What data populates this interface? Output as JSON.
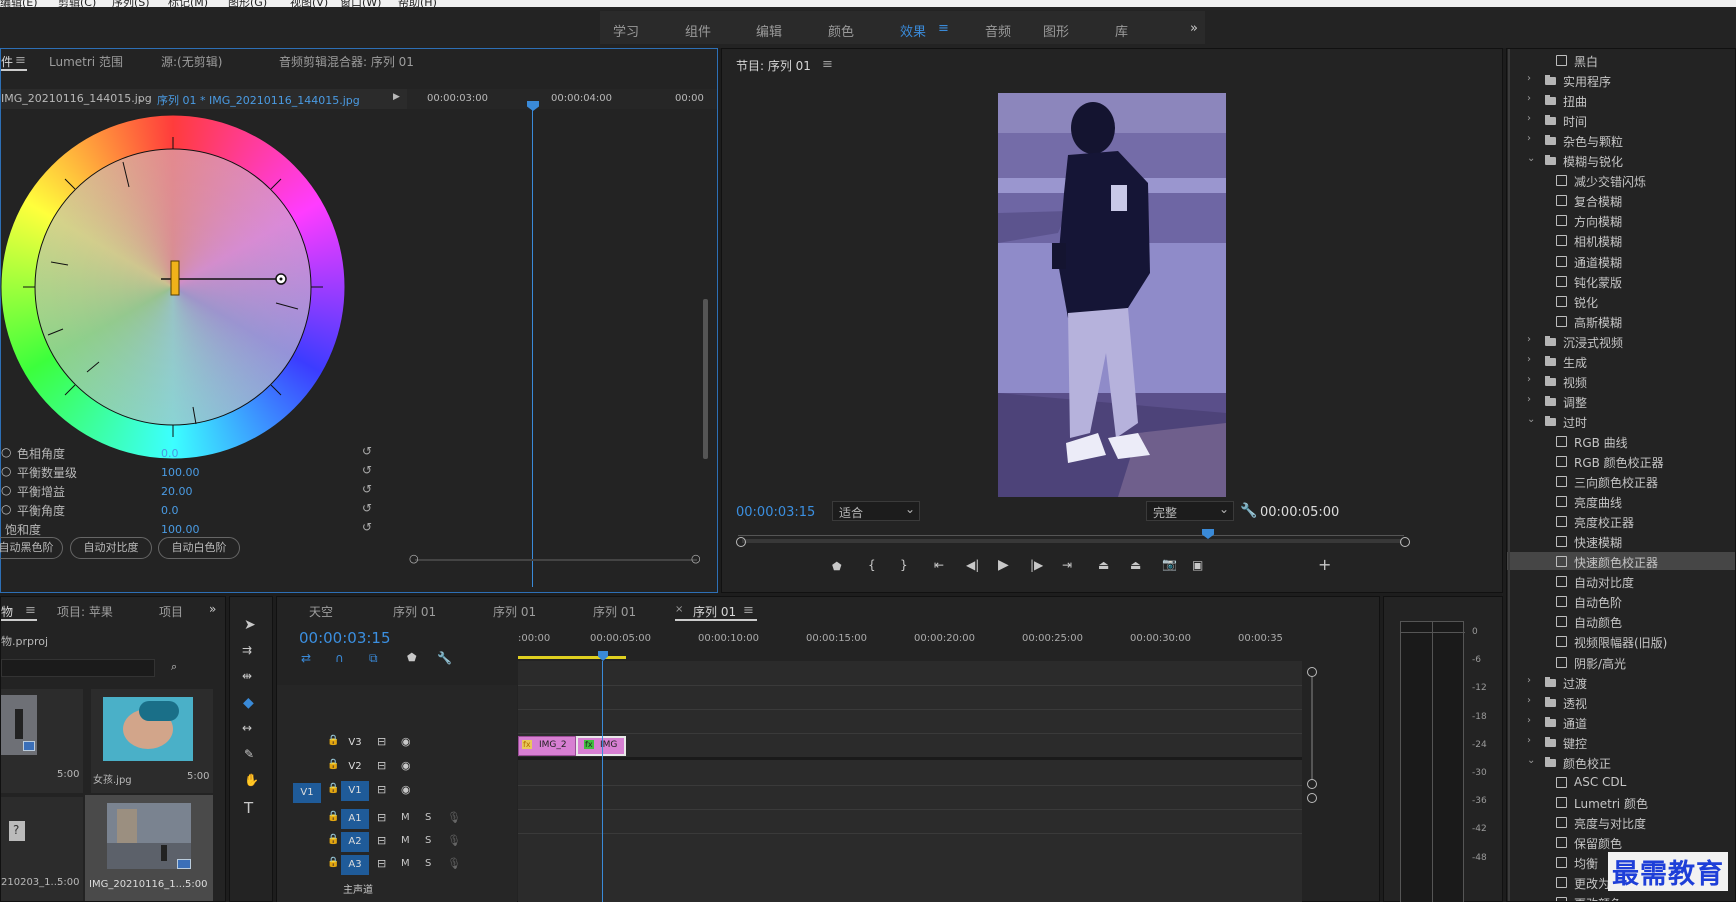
{
  "menubar": {
    "items": [
      "编辑(E)",
      "剪辑(C)",
      "序列(S)",
      "标记(M)",
      "图形(G)",
      "视图(V)",
      "窗口(W)",
      "帮助(H)"
    ]
  },
  "workspace": {
    "tabs": [
      "学习",
      "组件",
      "编辑",
      "颜色",
      "效果",
      "音频",
      "图形",
      "库"
    ],
    "active": "效果",
    "more": "»"
  },
  "source_panel": {
    "tabs": [
      "件",
      "Lumetri 范围",
      "源:(无剪辑)",
      "音频剪辑混合器: 序列 01"
    ],
    "clip_left": "IMG_20210116_144015.jpg",
    "clip_right": "序列 01 * IMG_20210116_144015.jpg",
    "timecodes": [
      "00:00:03:00",
      "00:00:04:00",
      "00:00"
    ],
    "params": [
      {
        "label": "色相角度",
        "value": "0.0"
      },
      {
        "label": "平衡数量级",
        "value": "100.00"
      },
      {
        "label": "平衡增益",
        "value": "20.00"
      },
      {
        "label": "平衡角度",
        "value": "0.0"
      },
      {
        "label": "饱和度",
        "value": "100.00"
      }
    ],
    "buttons": [
      "自动黑色阶",
      "自动对比度",
      "自动白色阶"
    ]
  },
  "program_panel": {
    "title": "节目: 序列 01",
    "current_time": "00:00:03:15",
    "fit": "适合",
    "quality": "完整",
    "duration": "00:00:05:00"
  },
  "effects_panel": {
    "items": [
      {
        "label": "黑白",
        "level": 2,
        "kind": "fx"
      },
      {
        "label": "实用程序",
        "level": 1,
        "kind": "folder"
      },
      {
        "label": "扭曲",
        "level": 1,
        "kind": "folder"
      },
      {
        "label": "时间",
        "level": 1,
        "kind": "folder"
      },
      {
        "label": "杂色与颗粒",
        "level": 1,
        "kind": "folder"
      },
      {
        "label": "模糊与锐化",
        "level": 1,
        "kind": "folder-open"
      },
      {
        "label": "减少交错闪烁",
        "level": 2,
        "kind": "fx"
      },
      {
        "label": "复合模糊",
        "level": 2,
        "kind": "fx"
      },
      {
        "label": "方向模糊",
        "level": 2,
        "kind": "fx"
      },
      {
        "label": "相机模糊",
        "level": 2,
        "kind": "fx"
      },
      {
        "label": "通道模糊",
        "level": 2,
        "kind": "fx"
      },
      {
        "label": "钝化蒙版",
        "level": 2,
        "kind": "fx"
      },
      {
        "label": "锐化",
        "level": 2,
        "kind": "fx"
      },
      {
        "label": "高斯模糊",
        "level": 2,
        "kind": "fx"
      },
      {
        "label": "沉浸式视频",
        "level": 1,
        "kind": "folder"
      },
      {
        "label": "生成",
        "level": 1,
        "kind": "folder"
      },
      {
        "label": "视频",
        "level": 1,
        "kind": "folder"
      },
      {
        "label": "调整",
        "level": 1,
        "kind": "folder"
      },
      {
        "label": "过时",
        "level": 1,
        "kind": "folder-open"
      },
      {
        "label": "RGB 曲线",
        "level": 2,
        "kind": "fx"
      },
      {
        "label": "RGB 颜色校正器",
        "level": 2,
        "kind": "fx"
      },
      {
        "label": "三向颜色校正器",
        "level": 2,
        "kind": "fx"
      },
      {
        "label": "亮度曲线",
        "level": 2,
        "kind": "fx"
      },
      {
        "label": "亮度校正器",
        "level": 2,
        "kind": "fx"
      },
      {
        "label": "快速模糊",
        "level": 2,
        "kind": "fx"
      },
      {
        "label": "快速颜色校正器",
        "level": 2,
        "kind": "fx",
        "selected": true
      },
      {
        "label": "自动对比度",
        "level": 2,
        "kind": "fx"
      },
      {
        "label": "自动色阶",
        "level": 2,
        "kind": "fx"
      },
      {
        "label": "自动颜色",
        "level": 2,
        "kind": "fx"
      },
      {
        "label": "视频限幅器(旧版)",
        "level": 2,
        "kind": "fx"
      },
      {
        "label": "阴影/高光",
        "level": 2,
        "kind": "fx"
      },
      {
        "label": "过渡",
        "level": 1,
        "kind": "folder"
      },
      {
        "label": "透视",
        "level": 1,
        "kind": "folder"
      },
      {
        "label": "通道",
        "level": 1,
        "kind": "folder"
      },
      {
        "label": "键控",
        "level": 1,
        "kind": "folder"
      },
      {
        "label": "颜色校正",
        "level": 1,
        "kind": "folder-open"
      },
      {
        "label": "ASC CDL",
        "level": 2,
        "kind": "fx"
      },
      {
        "label": "Lumetri 颜色",
        "level": 2,
        "kind": "fx"
      },
      {
        "label": "亮度与对比度",
        "level": 2,
        "kind": "fx"
      },
      {
        "label": "保留颜色",
        "level": 2,
        "kind": "fx"
      },
      {
        "label": "均衡",
        "level": 2,
        "kind": "fx"
      },
      {
        "label": "更改为颜色",
        "level": 2,
        "kind": "fx"
      },
      {
        "label": "更改颜色",
        "level": 2,
        "kind": "fx"
      }
    ]
  },
  "project_panel": {
    "tabs": [
      "物",
      "项目: 苹果",
      "项目"
    ],
    "project_file": "物.prproj",
    "thumbs": [
      {
        "name": "",
        "duration": "5:00"
      },
      {
        "name": "女孩.jpg",
        "duration": "5:00"
      },
      {
        "name": "210203_1...",
        "duration": "5:00"
      },
      {
        "name": "IMG_20210116_1...",
        "duration": "5:00"
      }
    ]
  },
  "timeline_panel": {
    "tabs": [
      "天空",
      "序列 01",
      "序列 01",
      "序列 01",
      "序列 01"
    ],
    "current_time": "00:00:03:15",
    "ruler": [
      ":00:00",
      "00:00:05:00",
      "00:00:10:00",
      "00:00:15:00",
      "00:00:20:00",
      "00:00:25:00",
      "00:00:30:00",
      "00:00:35"
    ],
    "video_tracks": [
      "V3",
      "V2",
      "V1"
    ],
    "audio_tracks": [
      "A1",
      "A2",
      "A3"
    ],
    "source_patch": "V1",
    "master": "主声道",
    "clips": [
      {
        "label": "IMG_2",
        "fx": "fx"
      },
      {
        "label": "IMG",
        "fx": "fx"
      }
    ]
  },
  "audio_meter": {
    "labels": [
      "0",
      "-6",
      "-12",
      "-18",
      "-24",
      "-30",
      "-36",
      "-42",
      "-48"
    ]
  },
  "watermark": "最需教育"
}
